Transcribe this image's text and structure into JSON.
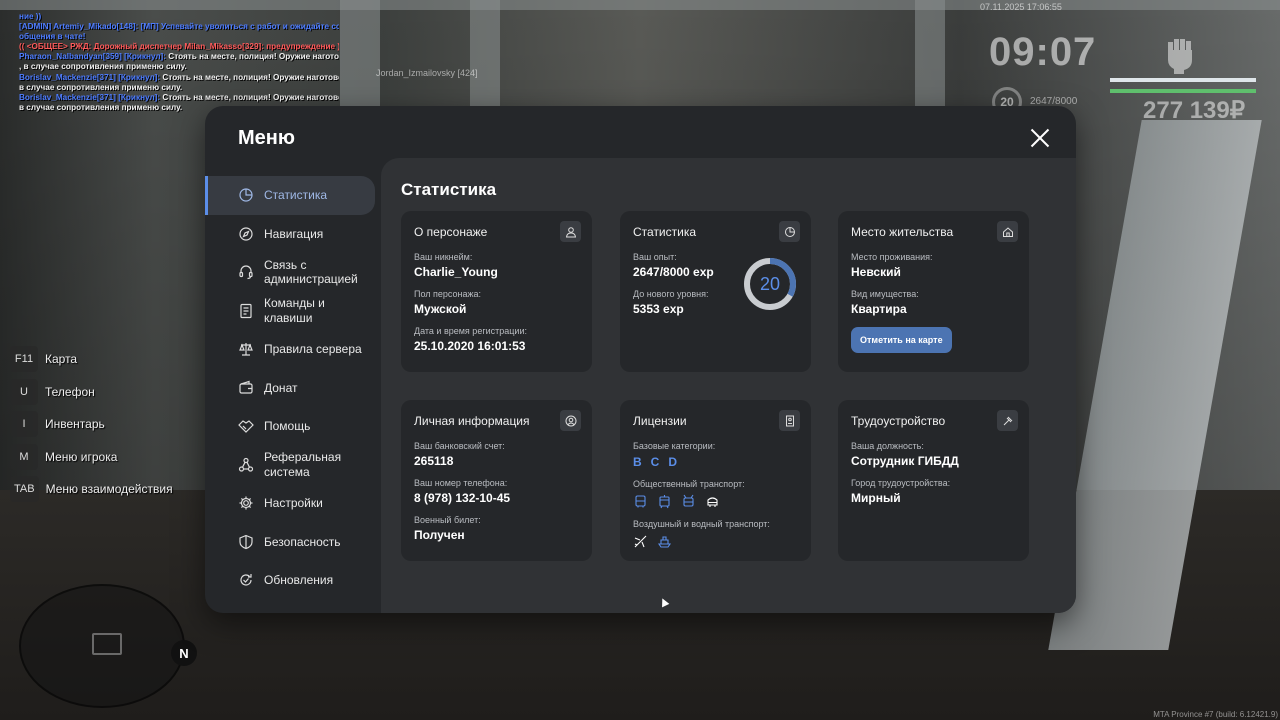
{
  "chat": [
    {
      "parts": [
        {
          "text": "ние ))",
          "c": "blue"
        }
      ]
    },
    {
      "parts": [
        {
          "text": "[ADMIN] Artemiy_Mikado[148]: [МП] Успевайте уволиться с работ и ожидайте со",
          "c": "blue"
        }
      ]
    },
    {
      "parts": [
        {
          "text": "общения в чате!",
          "c": "blue"
        }
      ]
    },
    {
      "parts": [
        {
          "text": "(( <ОБЩЕЕ> РЖД: Дорожный диспетчер Milan_Mikasso[329]: предупреждение ))",
          "c": "red"
        }
      ]
    },
    {
      "parts": [
        {
          "text": "Pharaon_Nalbandyan[359] [Крикнул]: ",
          "c": "blue"
        },
        {
          "text": "Стоять на месте, полиция! Оружие наготове",
          "c": "white"
        }
      ]
    },
    {
      "parts": [
        {
          "text": ", в случае сопротивления применю силу.",
          "c": "white"
        }
      ]
    },
    {
      "parts": [
        {
          "text": "Borislav_Mackenzie[371] [Крикнул]: ",
          "c": "blue"
        },
        {
          "text": "Стоять на месте, полиция! Оружие наготове,",
          "c": "white"
        }
      ]
    },
    {
      "parts": [
        {
          "text": " в случае сопротивления применю силу.",
          "c": "white"
        }
      ]
    },
    {
      "parts": [
        {
          "text": "Borislav_Mackenzie[371] [Крикнул]: ",
          "c": "blue"
        },
        {
          "text": "Стоять на месте, полиция! Оружие наготове,",
          "c": "white"
        }
      ]
    },
    {
      "parts": [
        {
          "text": " в случае сопротивления применю силу.",
          "c": "white"
        }
      ]
    }
  ],
  "player_tag": "Jordan_Izmailovsky [424]",
  "hud": {
    "date": "07.11.2025 17:06:55",
    "time": "09:07",
    "level": "20",
    "exp": "2647/8000",
    "money": "277 139₽",
    "bar_colors": [
      "#dfe6ea",
      "#5fbf6d"
    ]
  },
  "keybinds": [
    {
      "key": "F11",
      "label": "Карта"
    },
    {
      "key": "U",
      "label": "Телефон"
    },
    {
      "key": "I",
      "label": "Инвентарь"
    },
    {
      "key": "M",
      "label": "Меню игрока"
    },
    {
      "key": "TAB",
      "label": "Меню взаимодействия"
    }
  ],
  "minimap": {
    "north": "N"
  },
  "build": "MTA Province #7 (build: 6.12421.9)",
  "menu": {
    "title": "Меню",
    "close_icon": "close-icon",
    "sidebar": [
      {
        "label": "Статистика",
        "icon": "chart-pie-icon",
        "active": true
      },
      {
        "label": "Навигация",
        "icon": "compass-icon"
      },
      {
        "label": "Связь с администрацией",
        "icon": "headset-icon"
      },
      {
        "label": "Команды и клавиши",
        "icon": "document-icon"
      },
      {
        "label": "Правила сервера",
        "icon": "scales-icon"
      },
      {
        "label": "Донат",
        "icon": "wallet-icon"
      },
      {
        "label": "Помощь",
        "icon": "handshake-icon"
      },
      {
        "label": "Реферальная система",
        "icon": "network-icon"
      },
      {
        "label": "Настройки",
        "icon": "gear-icon"
      },
      {
        "label": "Безопасность",
        "icon": "shield-icon"
      },
      {
        "label": "Обновления",
        "icon": "refresh-icon"
      }
    ],
    "content_title": "Статистика",
    "accent": "#5b8ee8",
    "cards": {
      "character": {
        "title": "О персонаже",
        "icon": "user-icon",
        "fields": [
          {
            "label": "Ваш никнейм:",
            "value": "Charlie_Young"
          },
          {
            "label": "Пол персонажа:",
            "value": "Мужской"
          },
          {
            "label": "Дата и время регистрации:",
            "value": "25.10.2020 16:01:53"
          }
        ]
      },
      "stats": {
        "title": "Статистика",
        "icon": "chart-pie-icon",
        "fields": [
          {
            "label": "Ваш опыт:",
            "value": "2647/8000 exp"
          },
          {
            "label": "До нового уровня:",
            "value": "5353 exp"
          }
        ],
        "level": "20",
        "exp_current": 2647,
        "exp_max": 8000
      },
      "residence": {
        "title": "Место жительства",
        "icon": "home-icon",
        "fields": [
          {
            "label": "Место проживания:",
            "value": "Невский"
          },
          {
            "label": "Вид имущества:",
            "value": "Квартира"
          }
        ],
        "button": "Отметить на карте"
      },
      "personal": {
        "title": "Личная информация",
        "icon": "user-circle-icon",
        "fields": [
          {
            "label": "Ваш банковский счет:",
            "value": "265118"
          },
          {
            "label": "Ваш номер телефона:",
            "value": "8 (978) 132-10-45"
          },
          {
            "label": "Военный билет:",
            "value": "Получен"
          }
        ]
      },
      "licenses": {
        "title": "Лицензии",
        "icon": "id-card-icon",
        "base_label": "Базовые категории:",
        "base_categories": [
          "B",
          "C",
          "D"
        ],
        "public_label": "Общественный транспорт:",
        "public_icons": [
          "bus-icon",
          "tram-icon",
          "trolleybus-icon",
          "taxi-icon"
        ],
        "air_label": "Воздушный и водный транспорт:",
        "air_icons": [
          "plane-icon",
          "boat-icon"
        ]
      },
      "employment": {
        "title": "Трудоустройство",
        "icon": "hammer-icon",
        "fields": [
          {
            "label": "Ваша должность:",
            "value": "Сотрудник ГИБДД"
          },
          {
            "label": "Город трудоустройства:",
            "value": "Мирный"
          }
        ]
      }
    }
  }
}
